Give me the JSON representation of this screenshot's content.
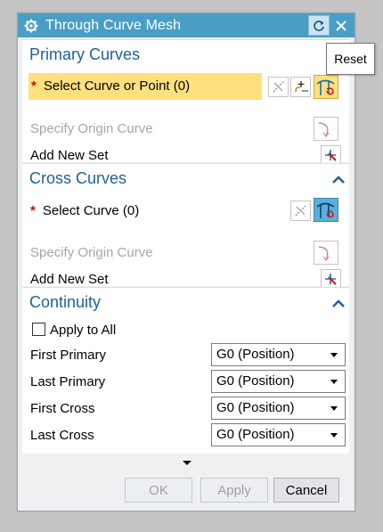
{
  "window": {
    "title": "Through Curve Mesh",
    "tooltip": "Reset"
  },
  "primary": {
    "title": "Primary Curves",
    "select_label": "Select Curve or Point (0)",
    "required_mark": "*",
    "origin_label": "Specify Origin Curve",
    "add_set_label": "Add New Set"
  },
  "cross": {
    "title": "Cross Curves",
    "select_label": "Select Curve (0)",
    "required_mark": "*",
    "origin_label": "Specify Origin Curve",
    "add_set_label": "Add New Set"
  },
  "continuity": {
    "title": "Continuity",
    "apply_all_label": "Apply to All",
    "rows": [
      {
        "label": "First Primary",
        "value": "G0 (Position)"
      },
      {
        "label": "Last Primary",
        "value": "G0 (Position)"
      },
      {
        "label": "First Cross",
        "value": "G0 (Position)"
      },
      {
        "label": "Last Cross",
        "value": "G0 (Position)"
      }
    ]
  },
  "buttons": {
    "ok": "OK",
    "apply": "Apply",
    "cancel": "Cancel"
  },
  "colors": {
    "titlebar": "#4a9ec5",
    "group_title": "#1f5f99",
    "selection_highlight": "#ffe07f",
    "required": "#e00000"
  }
}
